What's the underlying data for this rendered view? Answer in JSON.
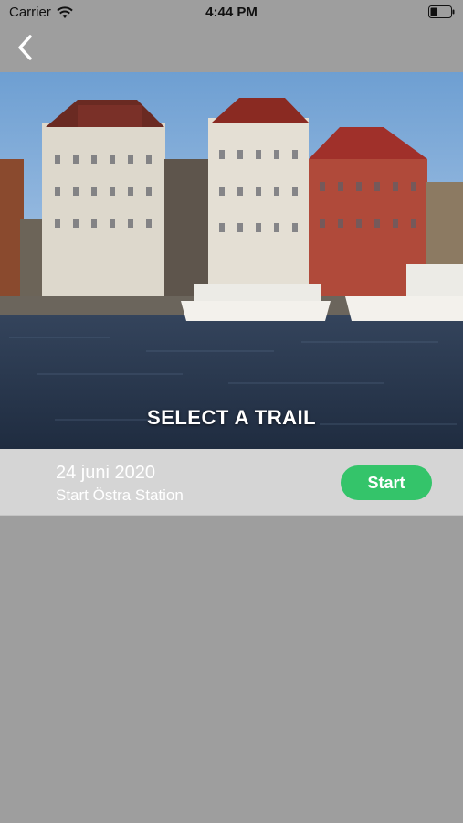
{
  "status_bar": {
    "carrier": "Carrier",
    "time": "4:44 PM"
  },
  "hero": {
    "title": "SELECT A TRAIL",
    "image": "stockholm-waterfront-photo"
  },
  "trail": {
    "date": "24 juni 2020",
    "start": "Start Östra Station",
    "button_label": "Start"
  },
  "colors": {
    "button": "#34c46a",
    "background": "#9e9e9e",
    "card": "#d5d5d5"
  }
}
